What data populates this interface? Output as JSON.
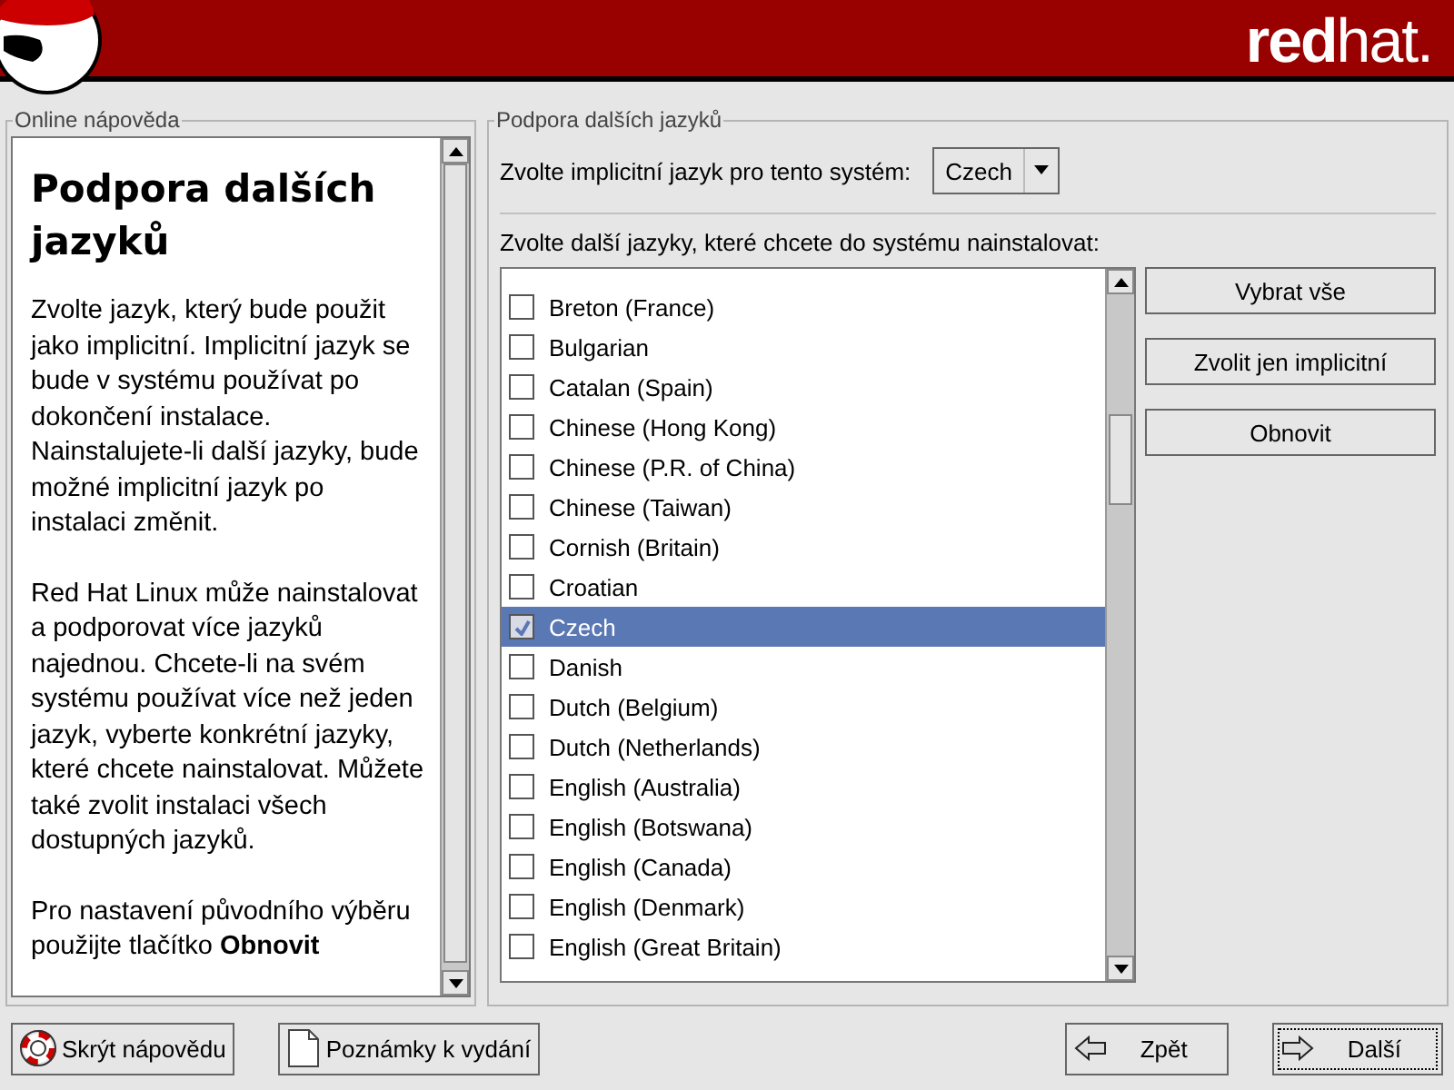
{
  "header": {
    "brand": "**red**hat."
  },
  "help_panel": {
    "title": "Online nápověda",
    "heading": "Podpora dalších jazyků",
    "paragraphs": [
      "Zvolte jazyk, který bude použit jako implicitní. Implicitní jazyk se bude v systému používat po dokončení instalace. Nainstalujete-li další jazyky, bude možné implicitní jazyk po instalaci změnit.",
      "Red Hat Linux může nainstalovat a podporovat více jazyků najednou. Chcete-li na svém systému používat více než jeden jazyk, vyberte konkrétní jazyky, které chcete nainstalovat. Můžete také zvolit instalaci všech dostupných jazyků.",
      "Pro nastavení původního výběru použijte tlačítko **Obnovit**"
    ]
  },
  "language_panel": {
    "title": "Podpora dalších jazyků",
    "default_label": "Zvolte implicitní jazyk pro tento systém:",
    "default_value": "Czech",
    "list_label": "Zvolte další jazyky, které chcete do systému nainstalovat:",
    "languages": [
      {
        "name": "Breton (France)",
        "checked": false,
        "selected": false
      },
      {
        "name": "Bulgarian",
        "checked": false,
        "selected": false
      },
      {
        "name": "Catalan (Spain)",
        "checked": false,
        "selected": false
      },
      {
        "name": "Chinese (Hong Kong)",
        "checked": false,
        "selected": false
      },
      {
        "name": "Chinese (P.R. of China)",
        "checked": false,
        "selected": false
      },
      {
        "name": "Chinese (Taiwan)",
        "checked": false,
        "selected": false
      },
      {
        "name": "Cornish (Britain)",
        "checked": false,
        "selected": false
      },
      {
        "name": "Croatian",
        "checked": false,
        "selected": false
      },
      {
        "name": "Czech",
        "checked": true,
        "selected": true
      },
      {
        "name": "Danish",
        "checked": false,
        "selected": false
      },
      {
        "name": "Dutch (Belgium)",
        "checked": false,
        "selected": false
      },
      {
        "name": "Dutch (Netherlands)",
        "checked": false,
        "selected": false
      },
      {
        "name": "English (Australia)",
        "checked": false,
        "selected": false
      },
      {
        "name": "English (Botswana)",
        "checked": false,
        "selected": false
      },
      {
        "name": "English (Canada)",
        "checked": false,
        "selected": false
      },
      {
        "name": "English (Denmark)",
        "checked": false,
        "selected": false
      },
      {
        "name": "English (Great Britain)",
        "checked": false,
        "selected": false
      }
    ],
    "actions": [
      "Vybrat vše",
      "Zvolit jen implicitní",
      "Obnovit"
    ]
  },
  "footer": [
    {
      "label": "Skrýt nápovědu",
      "kind": "lifebuoy",
      "focused": false
    },
    {
      "label": "Poznámky k vydání",
      "kind": "document",
      "focused": false
    },
    {
      "label": "Zpět",
      "kind": "back",
      "focused": false
    },
    {
      "label": "Další",
      "kind": "next",
      "focused": true
    }
  ]
}
